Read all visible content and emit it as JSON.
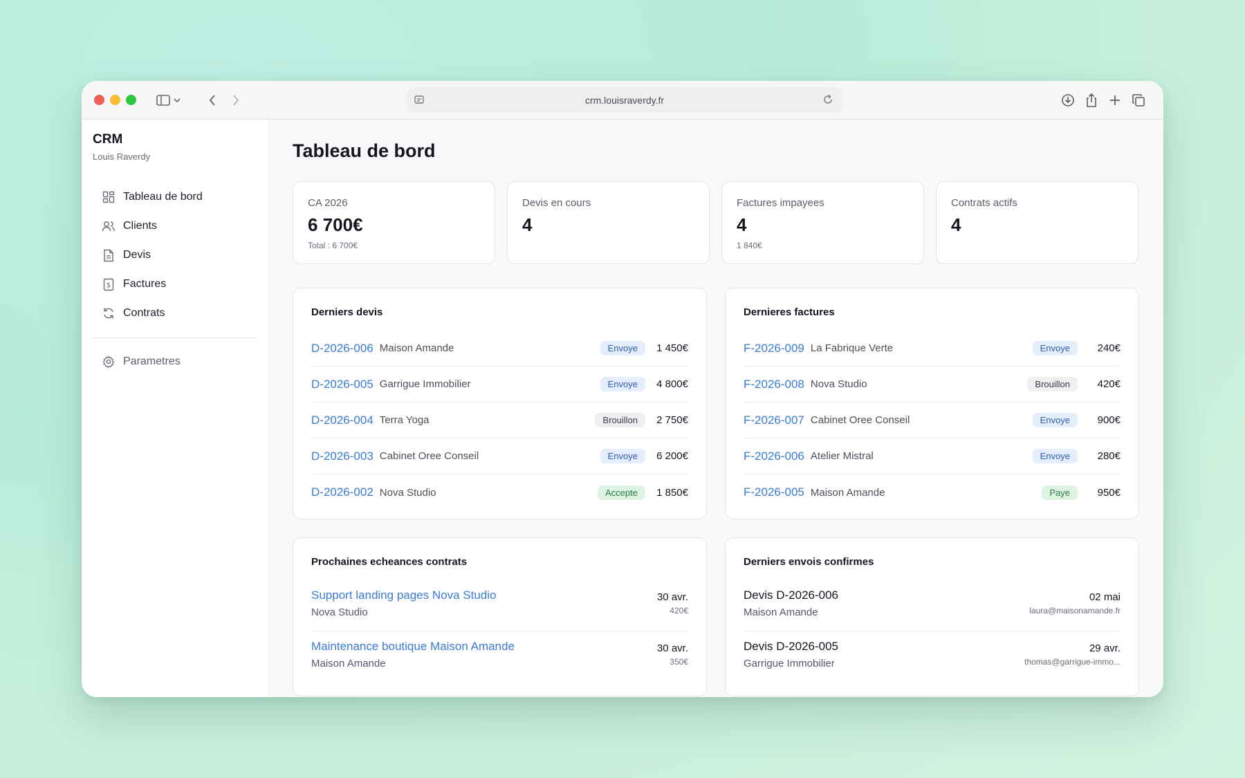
{
  "browser": {
    "url": "crm.louisraverdy.fr"
  },
  "sidebar": {
    "brand": "CRM",
    "user": "Louis Raverdy",
    "items": [
      {
        "label": "Tableau de bord",
        "icon": "dashboard-icon"
      },
      {
        "label": "Clients",
        "icon": "users-icon"
      },
      {
        "label": "Devis",
        "icon": "document-icon"
      },
      {
        "label": "Factures",
        "icon": "invoice-icon"
      },
      {
        "label": "Contrats",
        "icon": "refresh-icon"
      }
    ],
    "settings": {
      "label": "Parametres",
      "icon": "gear-icon"
    }
  },
  "main": {
    "title": "Tableau de bord",
    "stats": [
      {
        "label": "CA 2026",
        "value": "6 700€",
        "sub": "Total : 6 700€"
      },
      {
        "label": "Devis en cours",
        "value": "4",
        "sub": ""
      },
      {
        "label": "Factures impayees",
        "value": "4",
        "sub": "1 840€"
      },
      {
        "label": "Contrats actifs",
        "value": "4",
        "sub": ""
      }
    ],
    "devis": {
      "title": "Derniers devis",
      "rows": [
        {
          "ref": "D-2026-006",
          "client": "Maison Amande",
          "status": "Envoye",
          "amount": "1 450€"
        },
        {
          "ref": "D-2026-005",
          "client": "Garrigue Immobilier",
          "status": "Envoye",
          "amount": "4 800€"
        },
        {
          "ref": "D-2026-004",
          "client": "Terra Yoga",
          "status": "Brouillon",
          "amount": "2 750€"
        },
        {
          "ref": "D-2026-003",
          "client": "Cabinet Oree Conseil",
          "status": "Envoye",
          "amount": "6 200€"
        },
        {
          "ref": "D-2026-002",
          "client": "Nova Studio",
          "status": "Accepte",
          "amount": "1 850€"
        }
      ]
    },
    "factures": {
      "title": "Dernieres factures",
      "rows": [
        {
          "ref": "F-2026-009",
          "client": "La Fabrique Verte",
          "status": "Envoye",
          "amount": "240€"
        },
        {
          "ref": "F-2026-008",
          "client": "Nova Studio",
          "status": "Brouillon",
          "amount": "420€"
        },
        {
          "ref": "F-2026-007",
          "client": "Cabinet Oree Conseil",
          "status": "Envoye",
          "amount": "900€"
        },
        {
          "ref": "F-2026-006",
          "client": "Atelier Mistral",
          "status": "Envoye",
          "amount": "280€"
        },
        {
          "ref": "F-2026-005",
          "client": "Maison Amande",
          "status": "Paye",
          "amount": "950€"
        }
      ]
    },
    "contrats": {
      "title": "Prochaines echeances contrats",
      "rows": [
        {
          "title": "Support landing pages Nova Studio",
          "client": "Nova Studio",
          "date": "30 avr.",
          "amount": "420€"
        },
        {
          "title": "Maintenance boutique Maison Amande",
          "client": "Maison Amande",
          "date": "30 avr.",
          "amount": "350€"
        }
      ]
    },
    "envois": {
      "title": "Derniers envois confirmes",
      "rows": [
        {
          "title": "Devis D-2026-006",
          "client": "Maison Amande",
          "date": "02 mai",
          "email": "laura@maisonamande.fr"
        },
        {
          "title": "Devis D-2026-005",
          "client": "Garrigue Immobilier",
          "date": "29 avr.",
          "email": "thomas@garrigue-immo..."
        }
      ]
    }
  }
}
